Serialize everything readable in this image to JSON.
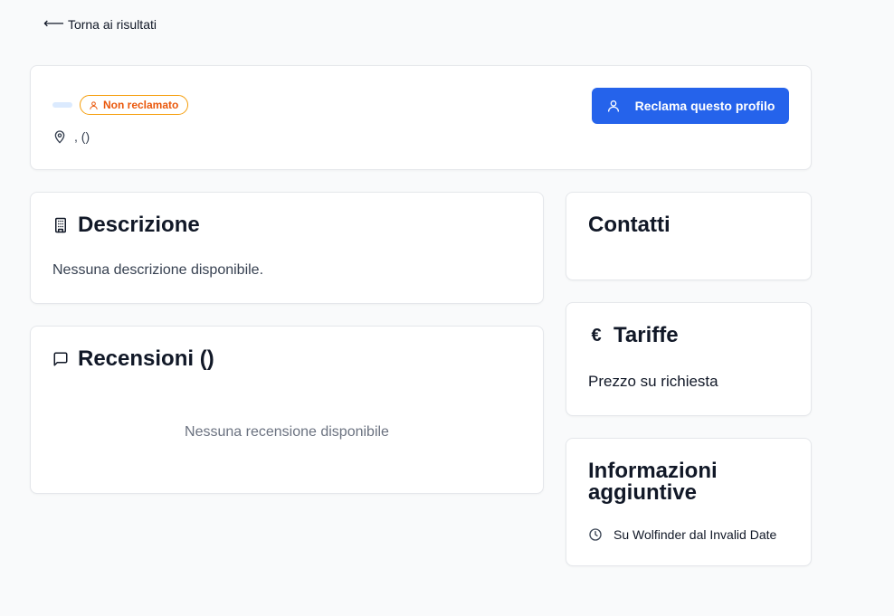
{
  "nav": {
    "back_arrow": "⟵",
    "back_label": "Torna ai risultati"
  },
  "profile": {
    "badge_label": "Non reclamato",
    "badge_icon": "user-icon",
    "location_text": ", ()",
    "location_icon": "map-pin-icon",
    "claim_button_label": "Reclama questo profilo",
    "claim_button_icon": "user-icon"
  },
  "description": {
    "title": "Descrizione",
    "icon": "building-icon",
    "text": "Nessuna descrizione disponibile."
  },
  "reviews": {
    "title": "Recensioni ()",
    "icon": "message-square-icon",
    "empty_text": "Nessuna recensione disponibile"
  },
  "contacts": {
    "title": "Contatti"
  },
  "rates": {
    "title": "Tariffe",
    "icon_glyph": "€",
    "text": "Prezzo su richiesta"
  },
  "info": {
    "title": "Informazioni aggiuntive",
    "icon": "clock-icon",
    "member_since": "Su Wolfinder dal Invalid Date"
  },
  "colors": {
    "primary": "#2563eb",
    "badge_border": "#f59e0b",
    "badge_text": "#ea580c",
    "background": "#f9fafb"
  }
}
